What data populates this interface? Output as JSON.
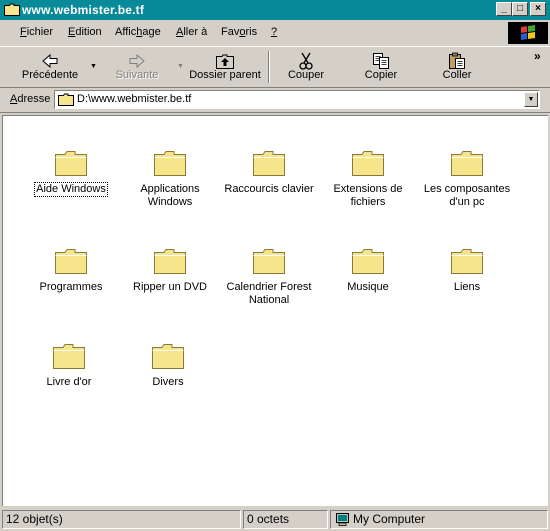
{
  "window": {
    "title": "www.webmister.be.tf",
    "colors": {
      "titlebar": "#098a98",
      "face": "#d4d0c8",
      "folder": "#f7e58c"
    }
  },
  "title_buttons": {
    "minimize": "_",
    "maximize": "□",
    "close": "×"
  },
  "menu": [
    {
      "pre": "",
      "u": "F",
      "post": "ichier"
    },
    {
      "pre": "",
      "u": "E",
      "post": "dition"
    },
    {
      "pre": "Affic",
      "u": "h",
      "post": "age"
    },
    {
      "pre": "",
      "u": "A",
      "post": "ller à"
    },
    {
      "pre": "Fav",
      "u": "o",
      "post": "ris"
    },
    {
      "pre": "",
      "u": "?",
      "post": ""
    }
  ],
  "toolbar": {
    "back_label": "Précédente",
    "forward_label": "Suivante",
    "up_label": "Dossier parent",
    "cut_label": "Couper",
    "copy_label": "Copier",
    "paste_label": "Coller",
    "dropdown_glyph": "▼",
    "chevron": "»"
  },
  "address": {
    "label_u": "A",
    "label_rest": "dresse",
    "value": "D:\\www.webmister.be.tf"
  },
  "folders": [
    {
      "name": "Aide Windows",
      "focused": true
    },
    {
      "name": "Applications Windows"
    },
    {
      "name": "Raccourcis clavier"
    },
    {
      "name": "Extensions de fichiers"
    },
    {
      "name": "Les composantes d'un pc"
    },
    {
      "name": "Programmes"
    },
    {
      "name": "Ripper un DVD"
    },
    {
      "name": "Calendrier Forest National"
    },
    {
      "name": "Musique"
    },
    {
      "name": "Liens"
    },
    {
      "name": "Livre d'or"
    },
    {
      "name": "Divers"
    }
  ],
  "status": {
    "objects": "12 objet(s)",
    "size": "0 octets",
    "zone": "My Computer"
  }
}
